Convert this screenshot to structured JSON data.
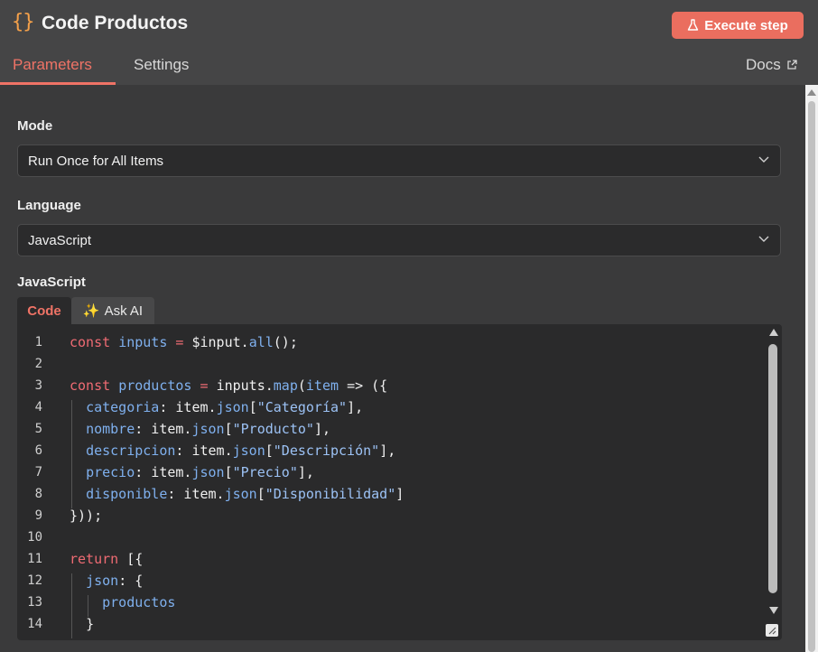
{
  "header": {
    "icon": "braces-icon",
    "icon_glyph": "{}",
    "title": "Code Productos",
    "execute_label": "Execute step",
    "accent_color": "#ea6e5f"
  },
  "tabs": [
    {
      "label": "Parameters",
      "active": true
    },
    {
      "label": "Settings",
      "active": false
    }
  ],
  "docs_label": "Docs",
  "mode": {
    "label": "Mode",
    "value": "Run Once for All Items"
  },
  "language": {
    "label": "Language",
    "value": "JavaScript"
  },
  "editor": {
    "label": "JavaScript",
    "tabs": {
      "code": "Code",
      "ask_ai": "Ask AI",
      "ask_ai_icon": "✨"
    },
    "lines": [
      {
        "n": "1"
      },
      {
        "n": "2"
      },
      {
        "n": "3"
      },
      {
        "n": "4"
      },
      {
        "n": "5"
      },
      {
        "n": "6"
      },
      {
        "n": "7"
      },
      {
        "n": "8"
      },
      {
        "n": "9"
      },
      {
        "n": "10"
      },
      {
        "n": "11"
      },
      {
        "n": "12"
      },
      {
        "n": "13"
      },
      {
        "n": "14"
      }
    ],
    "code": {
      "l1": [
        "const",
        "inputs",
        "=",
        "$input",
        ".",
        "all",
        "();"
      ],
      "l3": [
        "const",
        "productos",
        "=",
        "inputs",
        ".",
        "map",
        "(",
        "item",
        "=>",
        "({"
      ],
      "l4": [
        "categoria",
        ": item.",
        "json",
        "[",
        "\"Categoría\"",
        "],"
      ],
      "l5": [
        "nombre",
        ": item.",
        "json",
        "[",
        "\"Producto\"",
        "],"
      ],
      "l6": [
        "descripcion",
        ": item.",
        "json",
        "[",
        "\"Descripción\"",
        "],"
      ],
      "l7": [
        "precio",
        ": item.",
        "json",
        "[",
        "\"Precio\"",
        "],"
      ],
      "l8": [
        "disponible",
        ": item.",
        "json",
        "[",
        "\"Disponibilidad\"",
        "]"
      ],
      "l9": [
        "}));"
      ],
      "l11": [
        "return",
        "[{"
      ],
      "l12": [
        "json",
        ": {"
      ],
      "l13": [
        "productos"
      ],
      "l14": [
        "}"
      ]
    }
  }
}
